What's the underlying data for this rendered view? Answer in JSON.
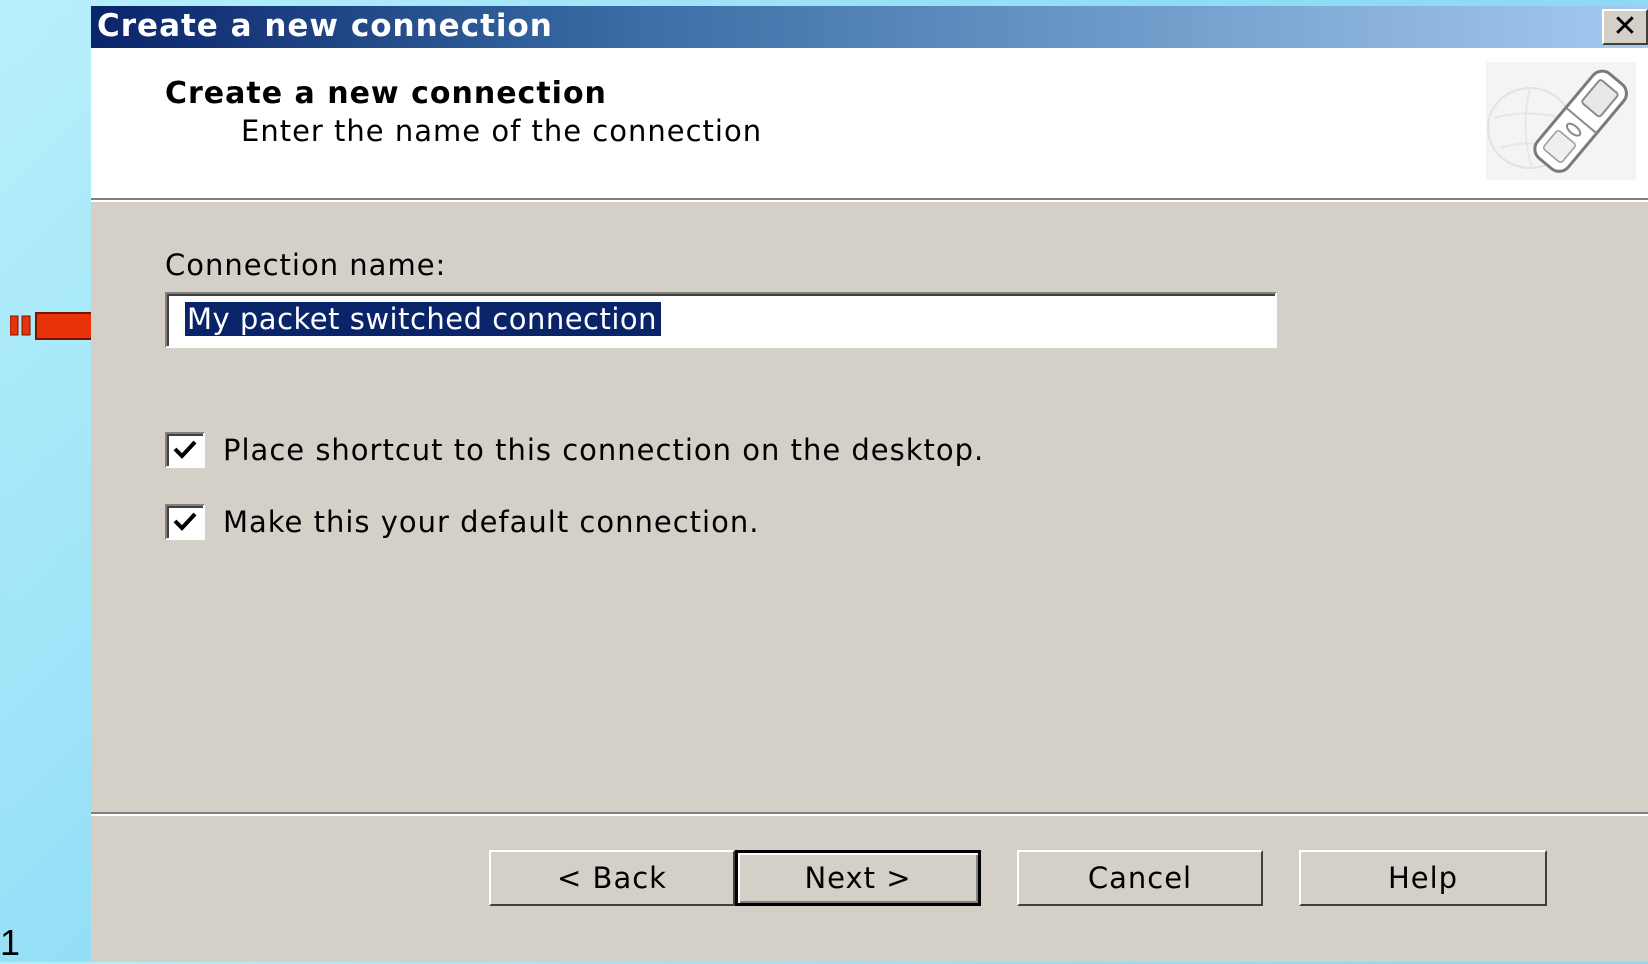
{
  "slide": {
    "number": "1"
  },
  "window": {
    "title": "Create a new connection",
    "close_label": "✕"
  },
  "header": {
    "title": "Create a new connection",
    "subtitle": "Enter the name of the connection",
    "icon": "mobile-phone-globe-icon"
  },
  "form": {
    "name_label": "Connection name:",
    "name_value": "My packet switched connection",
    "checkboxes": [
      {
        "label": "Place shortcut to this connection on the desktop.",
        "checked": true
      },
      {
        "label": "Make this your default connection.",
        "checked": true
      }
    ]
  },
  "buttons": {
    "back": "< Back",
    "next": "Next >",
    "cancel": "Cancel",
    "help": "Help"
  },
  "colors": {
    "title_bar_start": "#0a246a",
    "title_bar_end": "#a6caf0",
    "arrow": "#e8320a",
    "selection": "#0a246a",
    "dialog_face": "#d4d0c8"
  }
}
